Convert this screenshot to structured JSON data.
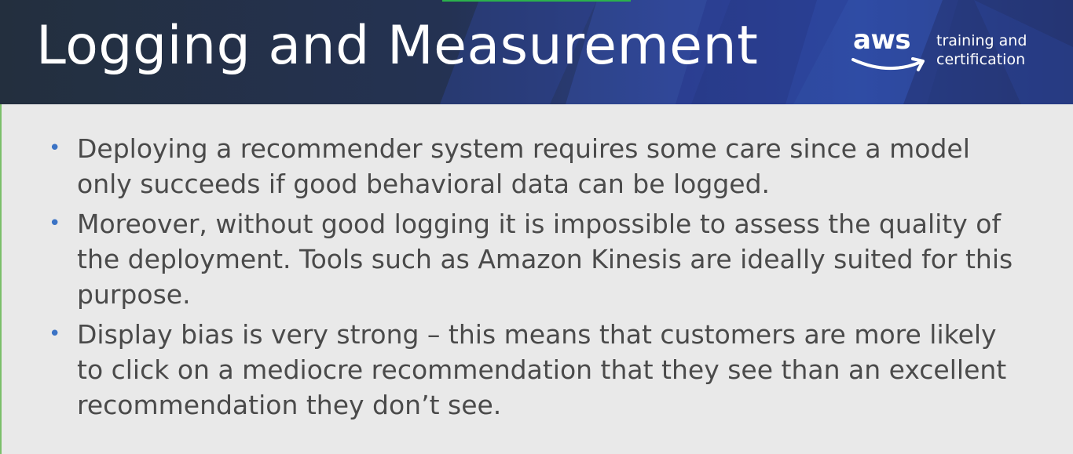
{
  "slide": {
    "title": "Logging and Measurement",
    "logo": {
      "wordmark": "aws",
      "tagline_line1": "training and",
      "tagline_line2": "certification",
      "icon": "aws-smile-icon"
    },
    "bullets": [
      {
        "marker": "•",
        "text": "Deploying a recommender system requires some care since a model only succeeds if good behavioral data can be logged."
      },
      {
        "marker": "•",
        "text": "Moreover, without good logging it is impossible to assess the quality of the deployment. Tools such as Amazon Kinesis are ideally suited for this purpose."
      },
      {
        "marker": "•",
        "text": "Display bias is very strong – this means that customers are more likely to click on a mediocre recommendation that they see than an excellent recommendation they don’t see."
      }
    ]
  },
  "colors": {
    "header_bg": "#232f3e",
    "header_accent": "#2e4a9e",
    "slide_bg": "#e9e9e9",
    "text": "#4a4a4a",
    "bullet": "#3b73c5",
    "smile": "#ffffff"
  }
}
